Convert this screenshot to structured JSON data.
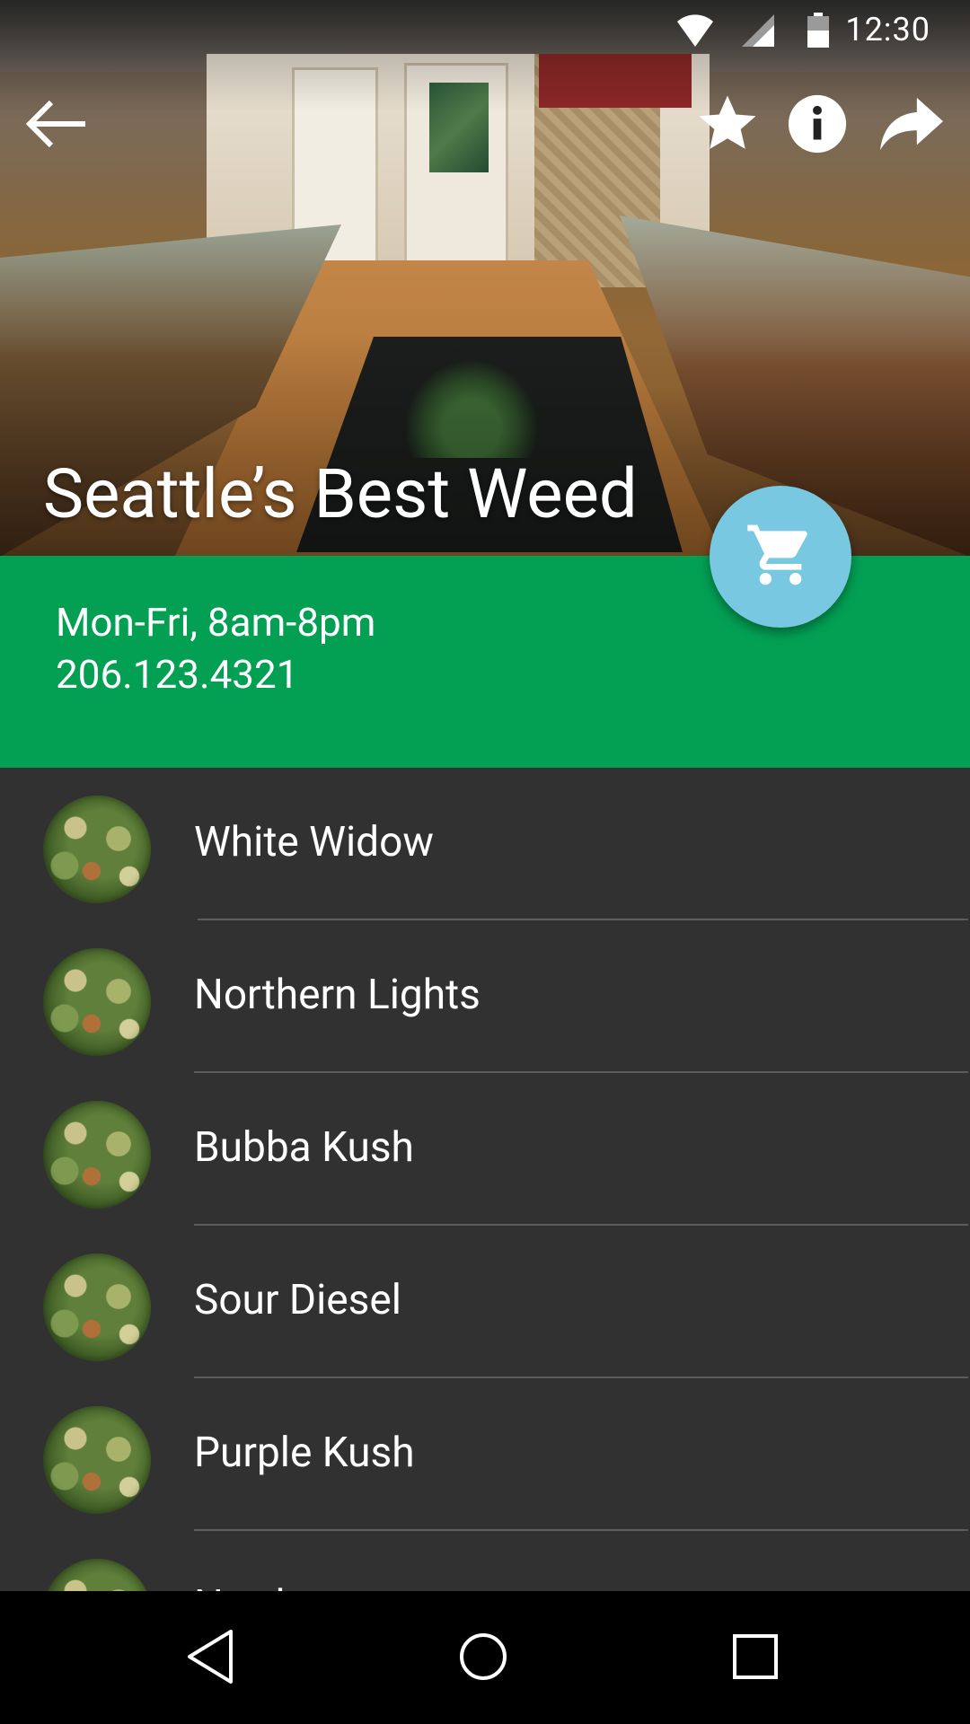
{
  "status_bar": {
    "time": "12:30",
    "icons": [
      "wifi-icon",
      "cell-signal-icon",
      "battery-icon"
    ]
  },
  "toolbar": {
    "back_icon": "arrow-left-icon",
    "actions": [
      "star-icon",
      "info-icon",
      "share-icon"
    ]
  },
  "store": {
    "name": "Seattle’s Best Weed",
    "hours": "Mon-Fri, 8am-8pm",
    "phone": "206.123.4321"
  },
  "fab": {
    "icon": "shopping-cart-icon"
  },
  "colors": {
    "info_band": "#03a054",
    "fab": "#78c8e2",
    "list_bg": "#313131",
    "nav_bg": "#000000"
  },
  "strains": [
    {
      "name": "White Widow"
    },
    {
      "name": "Northern Lights"
    },
    {
      "name": "Bubba Kush"
    },
    {
      "name": "Sour Diesel"
    },
    {
      "name": "Purple Kush"
    },
    {
      "name": "Northern"
    }
  ],
  "nav": {
    "icons": [
      "back-triangle-icon",
      "home-circle-icon",
      "recents-square-icon"
    ]
  }
}
